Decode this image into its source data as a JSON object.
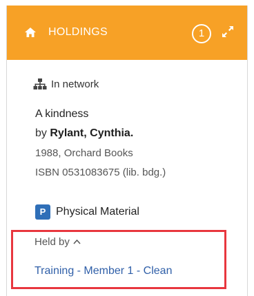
{
  "header": {
    "title": "HOLDINGS",
    "count": "1",
    "background_color": "#f7a126",
    "icons": [
      "home-icon",
      "expand-icon"
    ]
  },
  "network": {
    "icon": "network-icon",
    "label": "In network"
  },
  "record": {
    "title": "A kindness",
    "by_prefix": "by",
    "author": "Rylant, Cynthia.",
    "publication": "1988, Orchard Books",
    "isbn": "ISBN 0531083675 (lib. bdg.)"
  },
  "material": {
    "badge": "P",
    "label": "Physical Material",
    "badge_color": "#2f6fb8"
  },
  "held_by": {
    "label": "Held by",
    "icon": "caret-up-icon",
    "members": [
      "Training - Member 1 - Clean"
    ],
    "highlight_color": "#e8363e",
    "link_color": "#2f5fa8"
  }
}
